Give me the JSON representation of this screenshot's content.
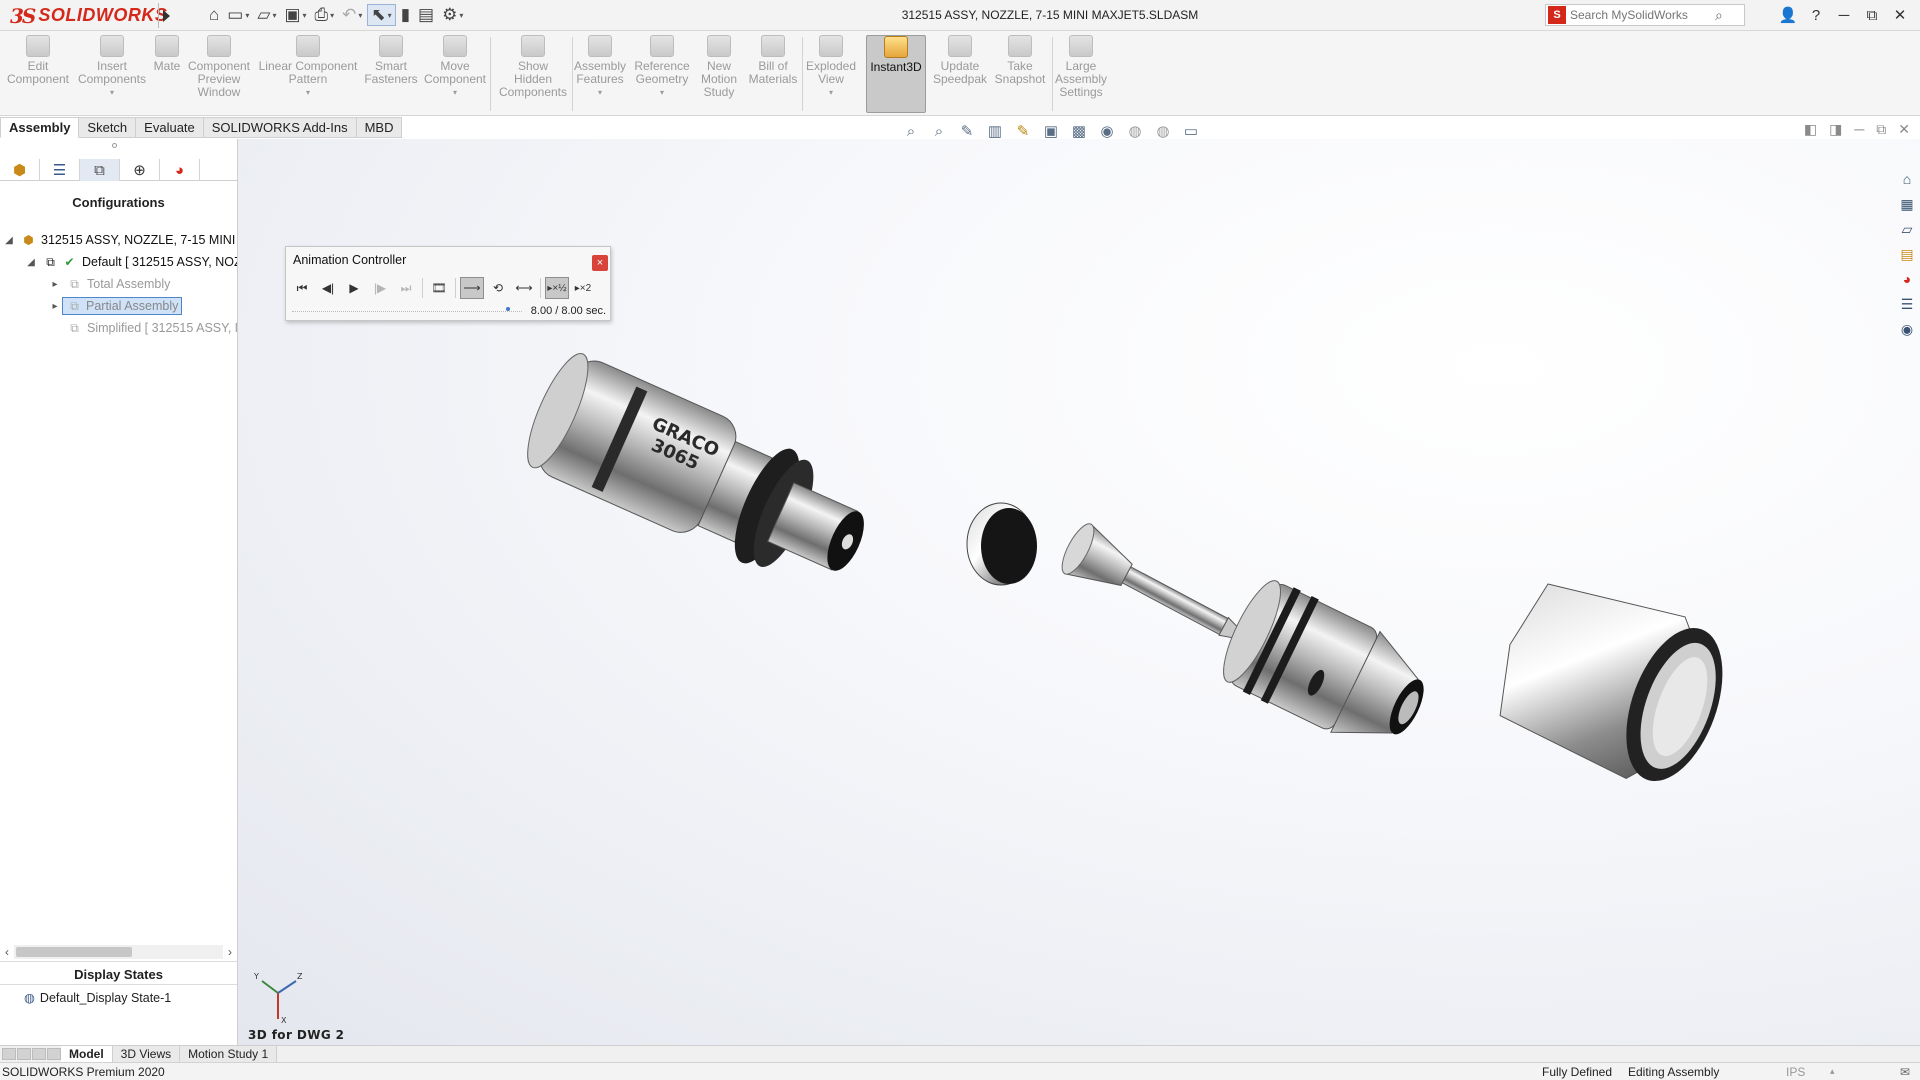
{
  "titlebar": {
    "logo_prefix": "3S",
    "logo_name": "SOLIDWORKS",
    "document_title": "312515 ASSY, NOZZLE, 7-15 MINI MAXJET5.SLDASM",
    "search_placeholder": "Search MySolidWorks",
    "quick_access_icons": [
      "home-icon",
      "new-icon",
      "open-icon",
      "save-icon",
      "print-icon",
      "undo-icon",
      "select-icon",
      "traffic-light-icon",
      "file-properties-icon",
      "options-icon"
    ],
    "window_icons": [
      "user-icon",
      "help-icon",
      "minimize-icon",
      "restore-icon",
      "close-icon"
    ]
  },
  "command_manager": {
    "buttons": [
      {
        "label": "Edit\nComponent"
      },
      {
        "label": "Insert\nComponents",
        "dropdown": "▾"
      },
      {
        "label": "Mate"
      },
      {
        "label": "Component\nPreview\nWindow"
      },
      {
        "label": "Linear Component\nPattern",
        "dropdown": "▾"
      },
      {
        "label": "Smart\nFasteners"
      },
      {
        "label": "Move\nComponent",
        "dropdown": "▾"
      },
      {
        "label": "Show\nHidden\nComponents"
      },
      {
        "label": "Assembly\nFeatures",
        "dropdown": "▾"
      },
      {
        "label": "Reference\nGeometry",
        "dropdown": "▾"
      },
      {
        "label": "New\nMotion\nStudy"
      },
      {
        "label": "Bill of\nMaterials"
      },
      {
        "label": "Exploded\nView",
        "dropdown": "▾"
      },
      {
        "label": "Instant3D",
        "active": true
      },
      {
        "label": "Update\nSpeedpak"
      },
      {
        "label": "Take\nSnapshot"
      },
      {
        "label": "Large\nAssembly\nSettings"
      }
    ]
  },
  "tabs": [
    "Assembly",
    "Sketch",
    "Evaluate",
    "SOLIDWORKS Add-Ins",
    "MBD"
  ],
  "left_panel": {
    "title": "Configurations",
    "tree": [
      {
        "label": "312515 ASSY, NOZZLE, 7-15 MINI M"
      },
      {
        "label": "Default [ 312515 ASSY, NOZ"
      },
      {
        "label": "Total Assembly"
      },
      {
        "label": "Partial Assembly"
      },
      {
        "label": "Simplified [ 312515 ASSY, N"
      }
    ],
    "display_states_title": "Display States",
    "display_state": "Default_Display State-1"
  },
  "graphics": {
    "view_name": "3D for DWG 2",
    "triad_x": "X",
    "triad_y": "Y",
    "triad_z": "Z",
    "part_marking": "3065",
    "part_brand": "GRACO"
  },
  "animation_controller": {
    "title": "Animation Controller",
    "close": "×",
    "time": "8.00 / 8.00 sec.",
    "speed_slow": "▸×½",
    "speed_fast": "▸×2",
    "playback_progress": 1.0
  },
  "bottom_tabs": [
    "Model",
    "3D Views",
    "Motion Study 1"
  ],
  "status": {
    "product": "SOLIDWORKS Premium 2020",
    "state": "Fully Defined",
    "mode": "Editing Assembly",
    "units": "IPS",
    "units_caret": "▴"
  },
  "colors": {
    "brand": "#d4281b",
    "selection": "#cfe2f8",
    "accent": "#4f86c9"
  }
}
